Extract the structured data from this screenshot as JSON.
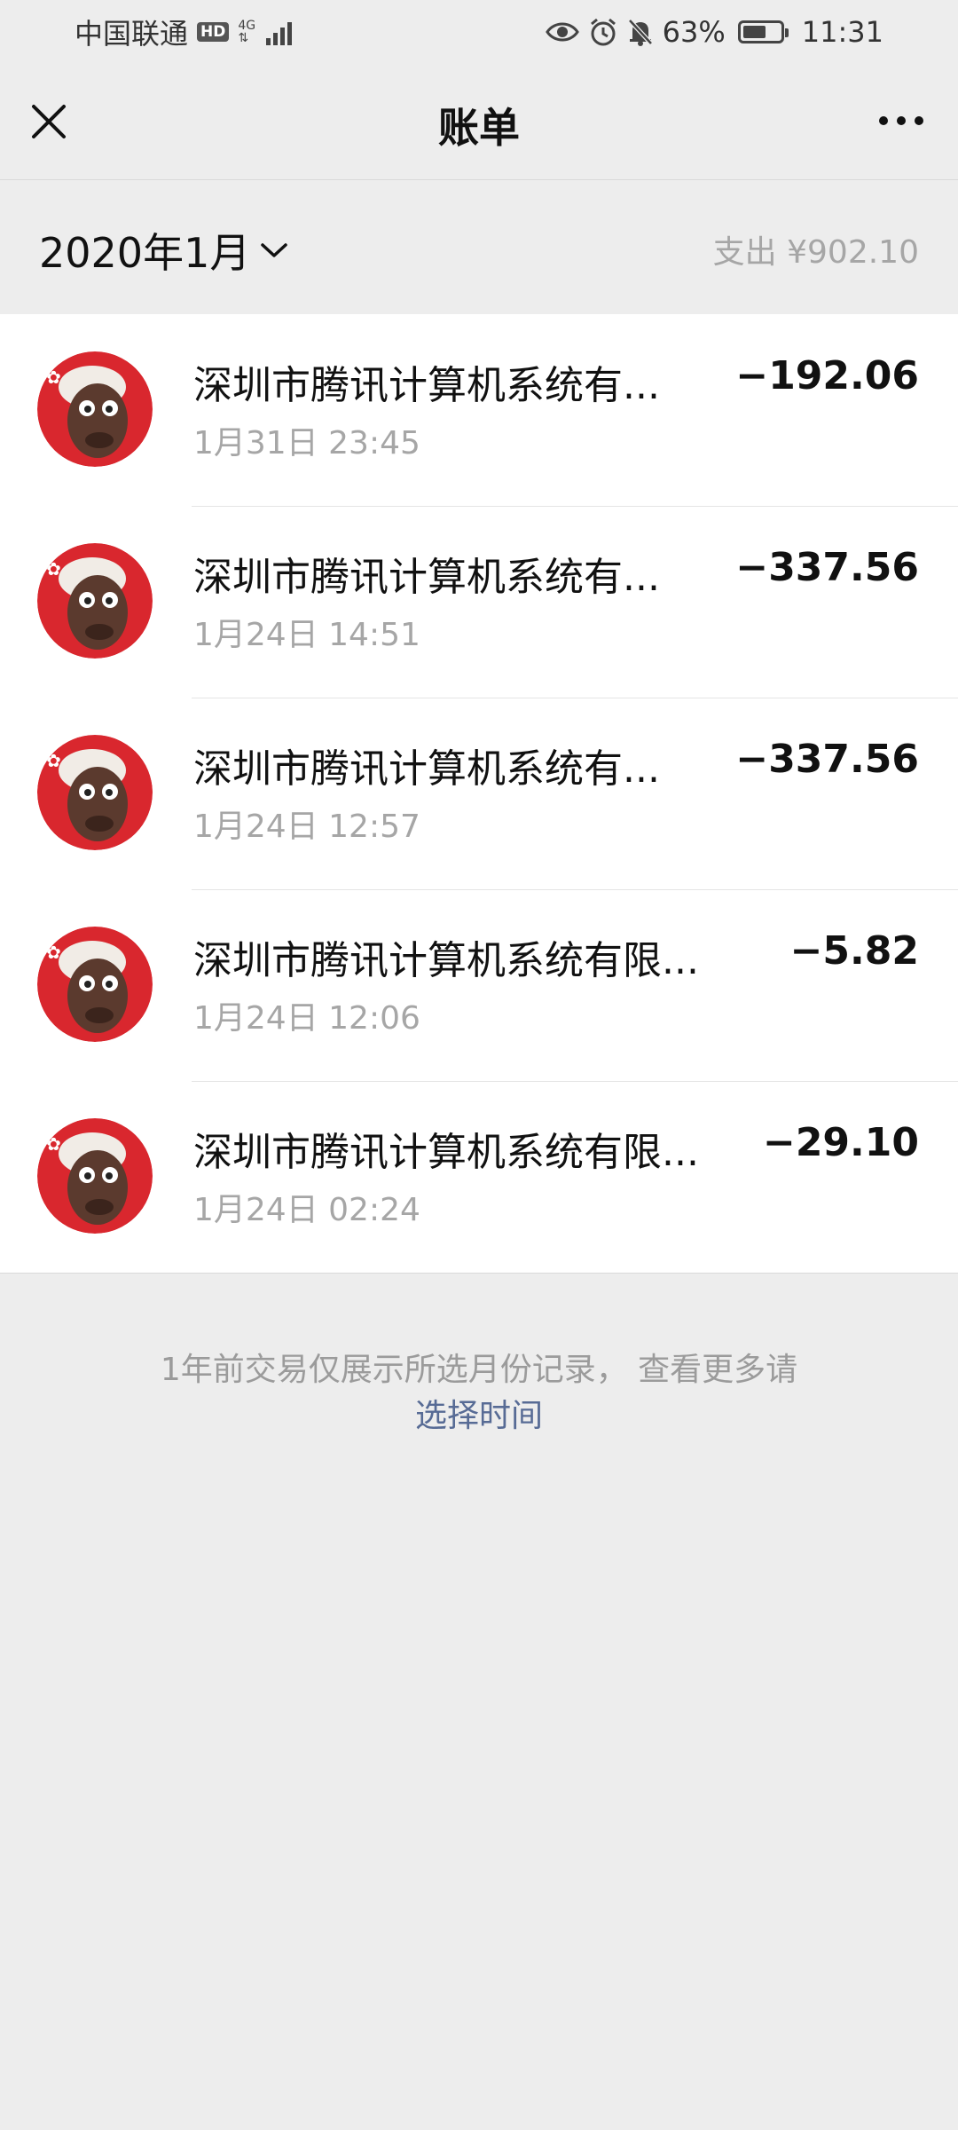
{
  "status_bar": {
    "carrier": "中国联通",
    "hd": "HD",
    "network": "4G",
    "battery": "63%",
    "time": "11:31",
    "battery_level": 0.63
  },
  "navbar": {
    "title": "账单",
    "close_icon": "close-icon",
    "more_icon": "more-icon"
  },
  "filter": {
    "month": "2020年1月",
    "summary": "支出 ¥902.10"
  },
  "transactions": [
    {
      "title": "深圳市腾讯计算机系统有...",
      "time": "1月31日 23:45",
      "amount": "−192.06"
    },
    {
      "title": "深圳市腾讯计算机系统有...",
      "time": "1月24日 14:51",
      "amount": "−337.56"
    },
    {
      "title": "深圳市腾讯计算机系统有...",
      "time": "1月24日 12:57",
      "amount": "−337.56"
    },
    {
      "title": "深圳市腾讯计算机系统有限...",
      "time": "1月24日 12:06",
      "amount": "−5.82"
    },
    {
      "title": "深圳市腾讯计算机系统有限...",
      "time": "1月24日 02:24",
      "amount": "−29.10"
    }
  ],
  "footer": {
    "note": "1年前交易仅展示所选月份记录， 查看更多请",
    "link": "选择时间"
  },
  "colors": {
    "background": "#ededed",
    "link": "#576b95",
    "secondary_text": "#a6a6a6"
  }
}
